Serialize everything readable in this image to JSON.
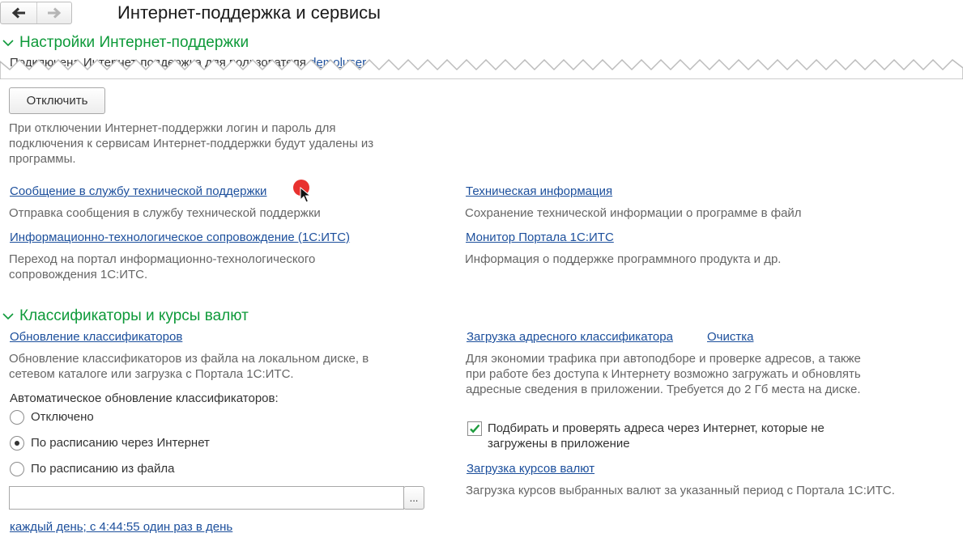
{
  "header": {
    "title": "Интернет-поддержка и сервисы"
  },
  "support": {
    "heading": "Настройки Интернет-поддержки",
    "connected_text": "Подключена Интернет-поддержка для пользователя",
    "connected_user": "demoluser",
    "disconnect_label": "Отключить",
    "disconnect_note": "При отключении Интернет-поддержки логин и пароль для подключения к сервисам Интернет-поддержки будут удалены из программы.",
    "message_link": "Сообщение в службу технической поддержки",
    "message_desc": "Отправка сообщения в службу технической поддержки",
    "its_link": "Информационно-технологическое сопровождение (1С:ИТС)",
    "its_desc": "Переход на портал информационно-технологического сопровождения 1С:ИТС.",
    "tech_link": "Техническая информация",
    "tech_desc": "Сохранение технической информации о программе в файл",
    "monitor_link": "Монитор Портала 1С:ИТС",
    "monitor_desc": "Информация о поддержке программного продукта и др."
  },
  "classifiers": {
    "heading": "Классификаторы и курсы валют",
    "update_link": "Обновление классификаторов",
    "update_desc": "Обновление классификаторов из файла на локальном диске, в сетевом каталоге или загрузка с Портала 1С:ИТС.",
    "auto_label": "Автоматическое обновление классификаторов:",
    "options": [
      "Отключено",
      "По расписанию через Интернет",
      "По расписанию из файла"
    ],
    "selected_option": "По расписанию через Интернет",
    "file_path": "",
    "browse_label": "...",
    "schedule_link": "каждый день; с 4:44:55 один раз в день",
    "address_link": "Загрузка адресного классификатора",
    "clear_link": "Очистка",
    "address_desc": "Для экономии трафика при автоподборе и проверке адресов, а также при работе без доступа к Интернету возможно загружать и обновлять адресные сведения в приложении. Требуется до 2 Гб места на диске.",
    "check_label": "Подбирать и проверять адреса через Интернет, которые не загружены в приложение",
    "check_value": true,
    "currency_link": "Загрузка курсов валют",
    "currency_desc": "Загрузка курсов выбранных валют за указанный период с Портала 1С:ИТС."
  },
  "colors": {
    "heading": "#0e9a3a",
    "link": "#1c4f9c",
    "check": "#1e9c3e",
    "cursor_marker": "#e8312f"
  },
  "icons": [
    "arrow-left-icon",
    "arrow-right-icon",
    "chevron-down-icon",
    "checkmark-icon",
    "mouse-cursor-icon"
  ]
}
